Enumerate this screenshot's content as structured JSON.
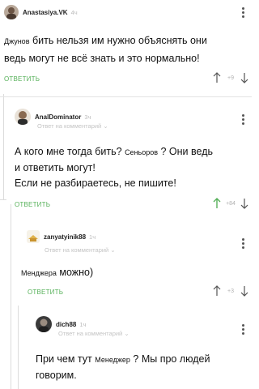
{
  "comments": [
    {
      "username": "Anastasiya.VK",
      "time": "4ч",
      "text_part1_small": "Джунов",
      "text_part1": " бить нельзя им нужно объяснять они",
      "text_line2": "ведь могут не всё знать и это нормально!",
      "reply_label": "ОТВЕТИТЬ",
      "score": "+9"
    },
    {
      "username": "AnalDominator",
      "time": "3ч",
      "reply_to": "Ответ на комментарий",
      "text_l1a": "А кого мне тогда бить? ",
      "text_l1_small": "Сеньоров",
      "text_l1b": " ? Они ведь",
      "text_line2": "и ответить могут!",
      "text_line3": "Если не разбираетесь, не пишите!",
      "reply_label": "ОТВЕТИТЬ",
      "score": "+84"
    },
    {
      "username": "zanyatyinik88",
      "time": "1ч",
      "reply_to": "Ответ на комментарий",
      "text_small": "Менджера",
      "text_rest": " можно)",
      "reply_label": "ОТВЕТИТЬ",
      "score": "+3"
    },
    {
      "username": "dich88",
      "time": "1ч",
      "reply_to": "Ответ на комментарий",
      "text_l1a": "При чем тут ",
      "text_l1_small": "Менеджер",
      "text_l1b": " ? Мы про людей",
      "text_line2": "говорим."
    }
  ],
  "icons": {
    "upvote": "arrow-up-icon",
    "downvote": "arrow-down-icon",
    "more": "more-vertical-icon",
    "chevron": "chevron-down-icon"
  },
  "colors": {
    "accent": "#57b15a",
    "muted": "#c4c4c4"
  }
}
